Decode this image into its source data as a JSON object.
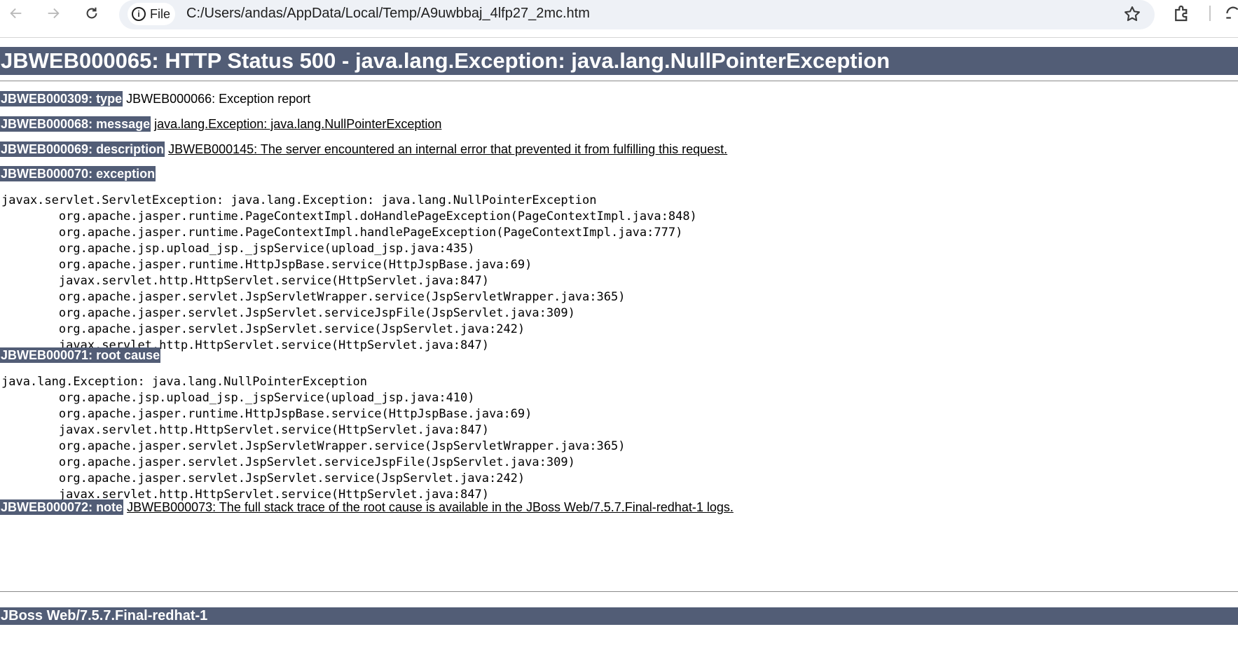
{
  "browser": {
    "url_chip_label": "File",
    "url": "C:/Users/andas/AppData/Local/Temp/A9uwbbaj_4lfp27_2mc.htm"
  },
  "page": {
    "title": "JBWEB000065: HTTP Status 500 - java.lang.Exception: java.lang.NullPointerException",
    "type_label": "JBWEB000309: type",
    "type_value": "JBWEB000066: Exception report",
    "message_label": "JBWEB000068: message",
    "message_value": "java.lang.Exception: java.lang.NullPointerException",
    "description_label": "JBWEB000069: description",
    "description_value": "JBWEB000145: The server encountered an internal error that prevented it from fulfilling this request.",
    "exception_label": "JBWEB000070: exception",
    "exception_trace": "javax.servlet.ServletException: java.lang.Exception: java.lang.NullPointerException\n\torg.apache.jasper.runtime.PageContextImpl.doHandlePageException(PageContextImpl.java:848)\n\torg.apache.jasper.runtime.PageContextImpl.handlePageException(PageContextImpl.java:777)\n\torg.apache.jsp.upload_jsp._jspService(upload_jsp.java:435)\n\torg.apache.jasper.runtime.HttpJspBase.service(HttpJspBase.java:69)\n\tjavax.servlet.http.HttpServlet.service(HttpServlet.java:847)\n\torg.apache.jasper.servlet.JspServletWrapper.service(JspServletWrapper.java:365)\n\torg.apache.jasper.servlet.JspServlet.serviceJspFile(JspServlet.java:309)\n\torg.apache.jasper.servlet.JspServlet.service(JspServlet.java:242)\n\tjavax.servlet.http.HttpServlet.service(HttpServlet.java:847)",
    "root_cause_label": "JBWEB000071: root cause",
    "root_cause_trace": "java.lang.Exception: java.lang.NullPointerException\n\torg.apache.jsp.upload_jsp._jspService(upload_jsp.java:410)\n\torg.apache.jasper.runtime.HttpJspBase.service(HttpJspBase.java:69)\n\tjavax.servlet.http.HttpServlet.service(HttpServlet.java:847)\n\torg.apache.jasper.servlet.JspServletWrapper.service(JspServletWrapper.java:365)\n\torg.apache.jasper.servlet.JspServlet.serviceJspFile(JspServlet.java:309)\n\torg.apache.jasper.servlet.JspServlet.service(JspServlet.java:242)\n\tjavax.servlet.http.HttpServlet.service(HttpServlet.java:847)",
    "note_label": "JBWEB000072: note",
    "note_value": "JBWEB000073: The full stack trace of the root cause is available in the JBoss Web/7.5.7.Final-redhat-1 logs.",
    "footer": "JBoss Web/7.5.7.Final-redhat-1"
  },
  "colors": {
    "label_bg": "#525d76",
    "label_fg": "#ffffff",
    "omnibox_bg": "#eef1f6"
  },
  "icons": [
    "back-arrow-icon",
    "forward-arrow-icon",
    "reload-icon",
    "info-icon",
    "bookmark-star-icon",
    "extensions-icon",
    "profile-icon"
  ]
}
